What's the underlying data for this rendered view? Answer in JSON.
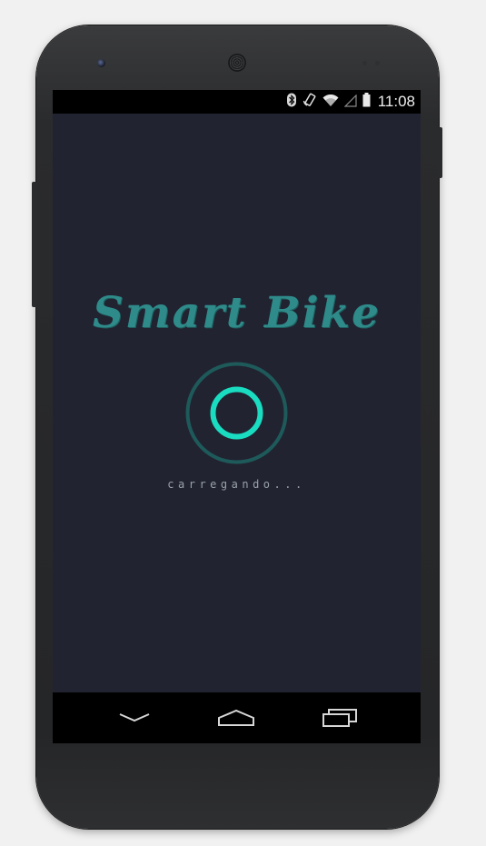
{
  "status_bar": {
    "time": "11:08",
    "icons": [
      "bluetooth-icon",
      "rotation-icon",
      "wifi-icon",
      "signal-icon",
      "battery-icon"
    ]
  },
  "splash": {
    "app_title": "Smart Bike",
    "loading_text": "carregando..."
  },
  "navigation_bar": {
    "buttons": [
      "back-button",
      "home-button",
      "recent-apps-button"
    ]
  },
  "colors": {
    "screen_background": "#212331",
    "title": "#2e8b8a",
    "loader_ring_outer": "#1e5a5a",
    "loader_ring_inner": "#19dcc0",
    "loading_text": "#9aa1a8"
  }
}
